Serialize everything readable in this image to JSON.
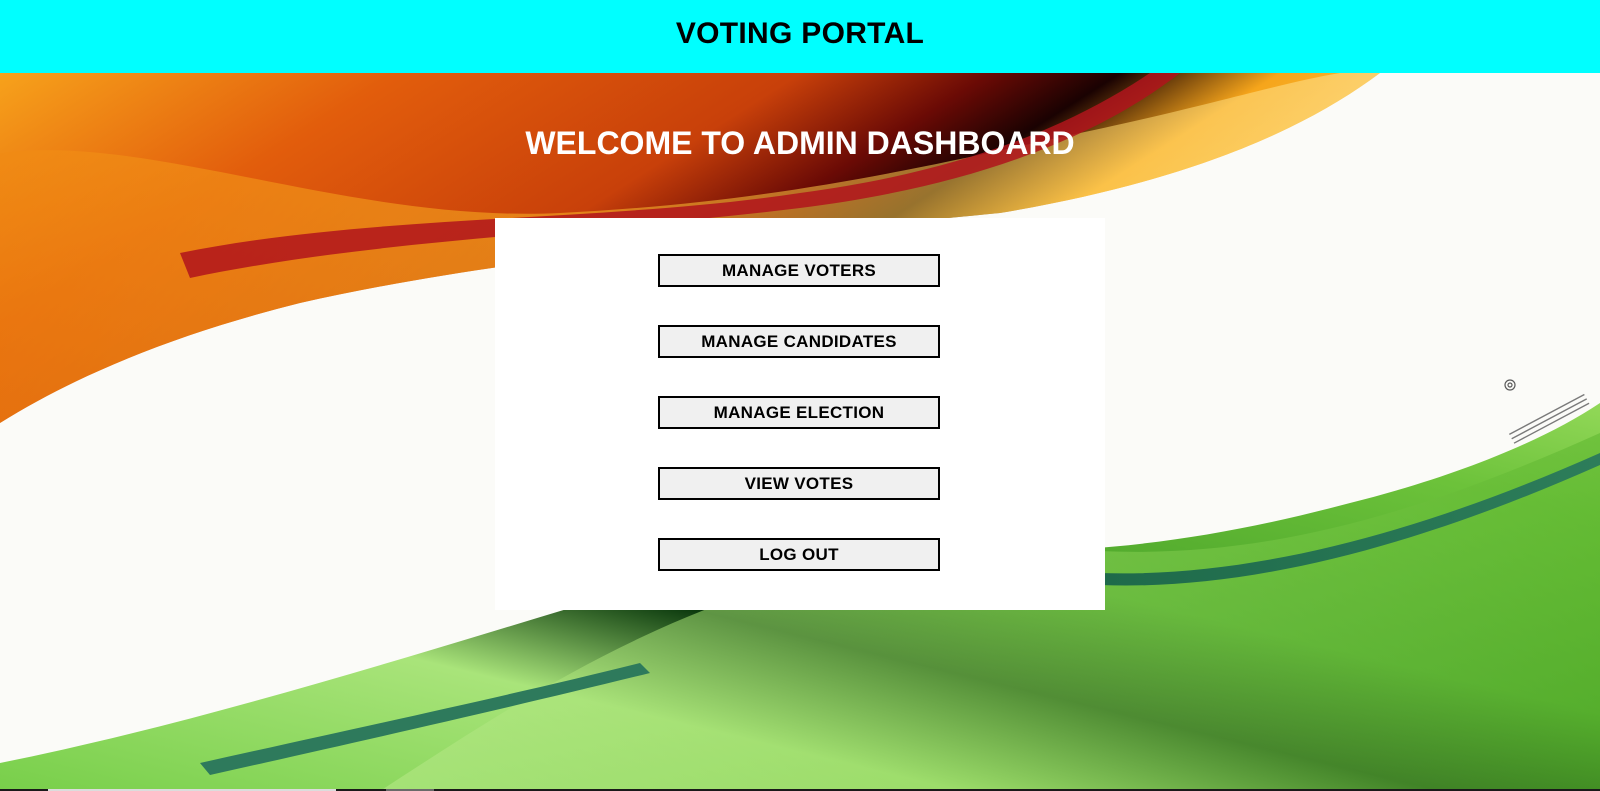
{
  "header": {
    "title": "VOTING PORTAL",
    "background_color": "#00ffff"
  },
  "welcome": {
    "heading": "WELCOME TO ADMIN DASHBOARD"
  },
  "menu": {
    "manage_voters": "MANAGE VOTERS",
    "manage_candidates": "MANAGE CANDIDATES",
    "manage_election": "MANAGE ELECTION",
    "view_votes": "VIEW VOTES",
    "log_out": "LOG OUT"
  },
  "background": {
    "image": "tricolor-flag-waves-image",
    "colors": {
      "saffron": "#e8600a",
      "white": "#ffffff",
      "green": "#5cb52e"
    }
  }
}
